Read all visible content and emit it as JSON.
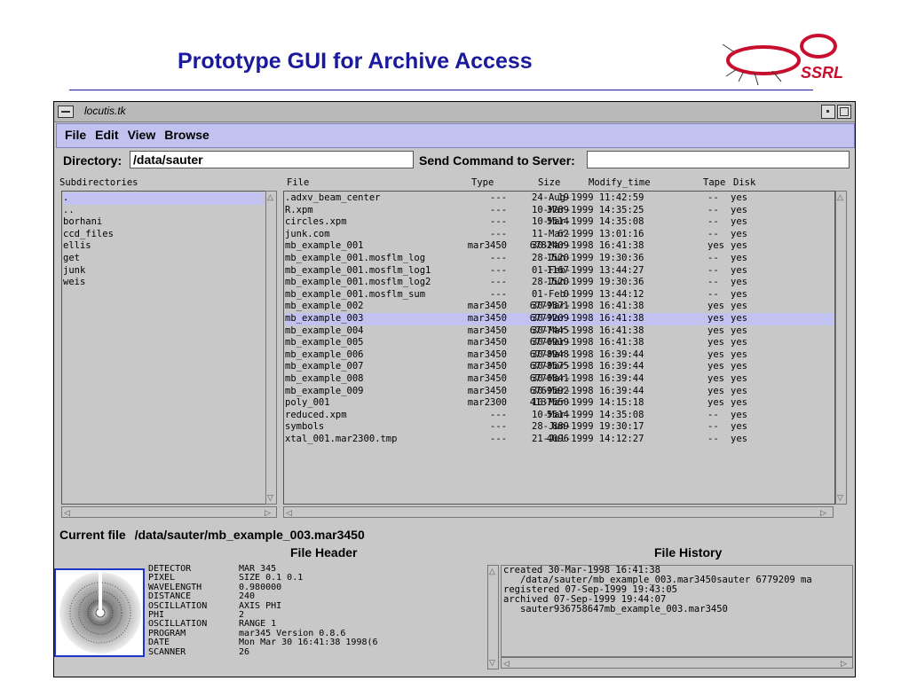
{
  "slide": {
    "title": "Prototype GUI for Archive Access",
    "logo_text": "SSRL"
  },
  "window": {
    "title": "locutis.tk"
  },
  "menu": [
    "File",
    "Edit",
    "View",
    "Browse"
  ],
  "directory": {
    "label": "Directory:",
    "value": "/data/sauter"
  },
  "command": {
    "label": "Send Command to Server:",
    "value": ""
  },
  "subdirectories": {
    "header": "Subdirectories",
    "items": [
      ".",
      "..",
      "borhani",
      "ccd_files",
      "ellis",
      "get",
      "junk",
      "weis"
    ],
    "selected_index": 0
  },
  "files": {
    "headers": {
      "file": "File",
      "type": "Type",
      "size": "Size",
      "modify_time": "Modify_time",
      "tape": "Tape",
      "disk": "Disk"
    },
    "selected_index": 10,
    "rows": [
      {
        "file": ".adxv_beam_center",
        "type": "---",
        "size": "19",
        "modify_time": "24-Aug-1999 11:42:59",
        "tape": "--",
        "disk": "yes"
      },
      {
        "file": "R.xpm",
        "type": "---",
        "size": "3789",
        "modify_time": "10-Mar-1999 14:35:25",
        "tape": "--",
        "disk": "yes"
      },
      {
        "file": "circles.xpm",
        "type": "---",
        "size": "5514",
        "modify_time": "10-Mar-1999 14:35:08",
        "tape": "--",
        "disk": "yes"
      },
      {
        "file": "junk.com",
        "type": "---",
        "size": "62",
        "modify_time": "11-Mar-1999 13:01:16",
        "tape": "--",
        "disk": "yes"
      },
      {
        "file": "mb_example_001",
        "type": "mar3450",
        "size": "6782409",
        "modify_time": "30-Mar-1998 16:41:38",
        "tape": "yes",
        "disk": "yes"
      },
      {
        "file": "mb_example_001.mosflm_log",
        "type": "---",
        "size": "1520",
        "modify_time": "28-Jun-1999 19:30:36",
        "tape": "--",
        "disk": "yes"
      },
      {
        "file": "mb_example_001.mosflm_log1",
        "type": "---",
        "size": "1167",
        "modify_time": "01-Feb-1999 13:44:27",
        "tape": "--",
        "disk": "yes"
      },
      {
        "file": "mb_example_001.mosflm_log2",
        "type": "---",
        "size": "1520",
        "modify_time": "28-Jun-1999 19:30:36",
        "tape": "--",
        "disk": "yes"
      },
      {
        "file": "mb_example_001.mosflm_sum",
        "type": "---",
        "size": "0",
        "modify_time": "01-Feb-1999 13:44:12",
        "tape": "--",
        "disk": "yes"
      },
      {
        "file": "mb_example_002",
        "type": "mar3450",
        "size": "6779371",
        "modify_time": "30-Mar-1998 16:41:38",
        "tape": "yes",
        "disk": "yes"
      },
      {
        "file": "mb_example_003",
        "type": "mar3450",
        "size": "6779209",
        "modify_time": "30-Mar-1998 16:41:38",
        "tape": "yes",
        "disk": "yes"
      },
      {
        "file": "mb_example_004",
        "type": "mar3450",
        "size": "6777445",
        "modify_time": "30-Mar-1998 16:41:38",
        "tape": "yes",
        "disk": "yes"
      },
      {
        "file": "mb_example_005",
        "type": "mar3450",
        "size": "6776919",
        "modify_time": "30-Mar-1998 16:41:38",
        "tape": "yes",
        "disk": "yes"
      },
      {
        "file": "mb_example_006",
        "type": "mar3450",
        "size": "6778948",
        "modify_time": "30-Mar-1998 16:39:44",
        "tape": "yes",
        "disk": "yes"
      },
      {
        "file": "mb_example_007",
        "type": "mar3450",
        "size": "6778575",
        "modify_time": "30-Mar-1998 16:39:44",
        "tape": "yes",
        "disk": "yes"
      },
      {
        "file": "mb_example_008",
        "type": "mar3450",
        "size": "6776841",
        "modify_time": "30-Mar-1998 16:39:44",
        "tape": "yes",
        "disk": "yes"
      },
      {
        "file": "mb_example_009",
        "type": "mar3450",
        "size": "6769592",
        "modify_time": "30-Mar-1998 16:39:44",
        "tape": "yes",
        "disk": "yes"
      },
      {
        "file": "poly_001",
        "type": "mar2300",
        "size": "4137650",
        "modify_time": "10-Mar-1999 14:15:18",
        "tape": "yes",
        "disk": "yes"
      },
      {
        "file": "reduced.xpm",
        "type": "---",
        "size": "5514",
        "modify_time": "10-Mar-1999 14:35:08",
        "tape": "--",
        "disk": "yes"
      },
      {
        "file": "symbols",
        "type": "---",
        "size": "889",
        "modify_time": "28-Jun-1999 19:30:17",
        "tape": "--",
        "disk": "yes"
      },
      {
        "file": "xtal_001.mar2300.tmp",
        "type": "---",
        "size": "4096",
        "modify_time": "21-Jul-1999 14:12:27",
        "tape": "--",
        "disk": "yes"
      }
    ]
  },
  "current_file": {
    "label": "Current file",
    "value": "/data/sauter/mb_example_003.mar3450"
  },
  "file_header": {
    "title": "File Header",
    "rows": [
      {
        "key": "DETECTOR",
        "value": "MAR 345"
      },
      {
        "key": "PIXEL",
        "value": "SIZE 0.1 0.1"
      },
      {
        "key": "WAVELENGTH",
        "value": "0.980000"
      },
      {
        "key": "DISTANCE",
        "value": "240"
      },
      {
        "key": "OSCILLATION",
        "value": "AXIS PHI"
      },
      {
        "key": "PHI",
        "value": "2"
      },
      {
        "key": "OSCILLATION",
        "value": "RANGE 1"
      },
      {
        "key": "PROGRAM",
        "value": "mar345 Version 0.8.6"
      },
      {
        "key": "DATE",
        "value": "Mon Mar 30 16:41:38 1998(6"
      },
      {
        "key": "SCANNER",
        "value": "26"
      }
    ]
  },
  "file_history": {
    "title": "File History",
    "lines": [
      "created 30-Mar-1998 16:41:38",
      "   /data/sauter/mb_example_003.mar3450sauter 6779209 ma",
      "registered 07-Sep-1999 19:43:05",
      "archived 07-Sep-1999 19:44:07",
      "   sauter936758647mb_example_003.mar3450"
    ]
  }
}
